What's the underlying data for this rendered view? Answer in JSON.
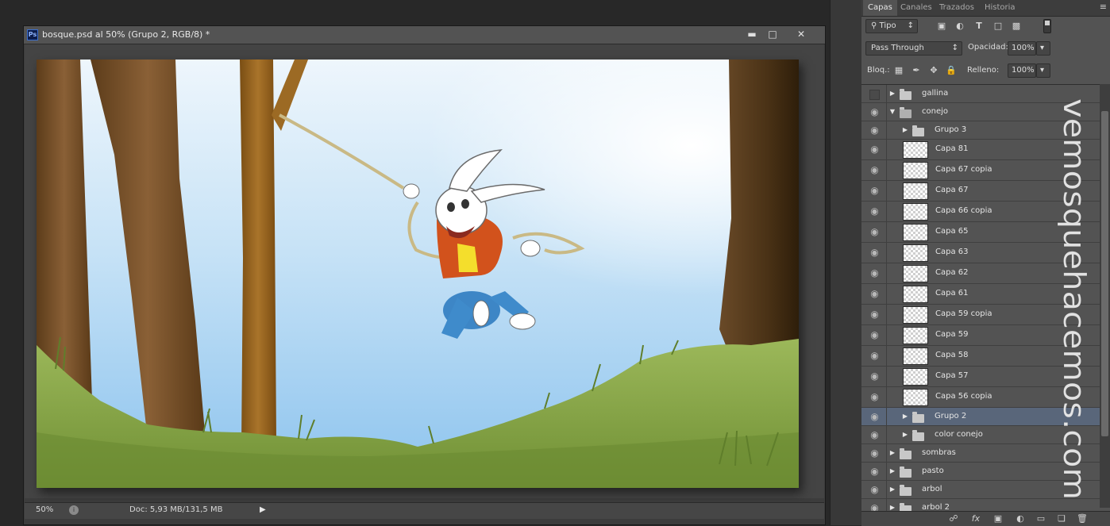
{
  "document": {
    "title": "bosque.psd al 50% (Grupo 2, RGB/8) *",
    "app_badge": "Ps",
    "zoom": "50%",
    "doc_info": "Doc: 5,93 MB/131,5 MB"
  },
  "panel": {
    "tabs": [
      {
        "label": "Capas",
        "active": true
      },
      {
        "label": "Canales",
        "active": false
      },
      {
        "label": "Trazados",
        "active": false
      },
      {
        "label": "Historia",
        "active": false
      }
    ],
    "filter_label": "Tipo",
    "blend_mode": "Pass Through",
    "opacity_label": "Opacidad:",
    "opacity_value": "100%",
    "lock_label": "Bloq.:",
    "fill_label": "Relleno:",
    "fill_value": "100%"
  },
  "layers": [
    {
      "name": "gallina",
      "kind": "group",
      "indent": 0,
      "visible": false,
      "expanded": false,
      "selected": false
    },
    {
      "name": "conejo",
      "kind": "group",
      "indent": 0,
      "visible": true,
      "expanded": true,
      "selected": false
    },
    {
      "name": "Grupo 3",
      "kind": "group",
      "indent": 1,
      "visible": true,
      "expanded": false,
      "selected": false
    },
    {
      "name": "Capa 81",
      "kind": "layer",
      "indent": 1,
      "visible": true,
      "selected": false
    },
    {
      "name": "Capa 67 copia",
      "kind": "layer",
      "indent": 1,
      "visible": true,
      "selected": false
    },
    {
      "name": "Capa 67",
      "kind": "layer",
      "indent": 1,
      "visible": true,
      "selected": false
    },
    {
      "name": "Capa 66 copia",
      "kind": "layer",
      "indent": 1,
      "visible": true,
      "selected": false
    },
    {
      "name": "Capa 65",
      "kind": "layer",
      "indent": 1,
      "visible": true,
      "selected": false
    },
    {
      "name": "Capa 63",
      "kind": "layer",
      "indent": 1,
      "visible": true,
      "selected": false
    },
    {
      "name": "Capa 62",
      "kind": "layer",
      "indent": 1,
      "visible": true,
      "selected": false
    },
    {
      "name": "Capa 61",
      "kind": "layer",
      "indent": 1,
      "visible": true,
      "selected": false
    },
    {
      "name": "Capa 59 copia",
      "kind": "layer",
      "indent": 1,
      "visible": true,
      "selected": false
    },
    {
      "name": "Capa 59",
      "kind": "layer",
      "indent": 1,
      "visible": true,
      "selected": false
    },
    {
      "name": "Capa 58",
      "kind": "layer",
      "indent": 1,
      "visible": true,
      "selected": false
    },
    {
      "name": "Capa 57",
      "kind": "layer",
      "indent": 1,
      "visible": true,
      "selected": false
    },
    {
      "name": "Capa 56 copia",
      "kind": "layer",
      "indent": 1,
      "visible": true,
      "selected": false
    },
    {
      "name": "Grupo 2",
      "kind": "group",
      "indent": 1,
      "visible": true,
      "expanded": false,
      "selected": true
    },
    {
      "name": "color conejo",
      "kind": "group",
      "indent": 1,
      "visible": true,
      "expanded": false,
      "selected": false
    },
    {
      "name": "sombras",
      "kind": "group",
      "indent": 0,
      "visible": true,
      "expanded": false,
      "selected": false
    },
    {
      "name": "pasto",
      "kind": "group",
      "indent": 0,
      "visible": true,
      "expanded": false,
      "selected": false
    },
    {
      "name": "arbol",
      "kind": "group",
      "indent": 0,
      "visible": true,
      "expanded": false,
      "selected": false
    },
    {
      "name": "arbol 2",
      "kind": "group",
      "indent": 0,
      "visible": true,
      "expanded": false,
      "selected": false
    }
  ],
  "watermark": "vemosquehacemos.com",
  "colors": {
    "panel_bg": "#535353",
    "selected_row": "#59667a",
    "workspace": "#282828",
    "sky": "#a9d3f2",
    "grass": "#7c9a3c",
    "trunk": "#8a5a22"
  }
}
